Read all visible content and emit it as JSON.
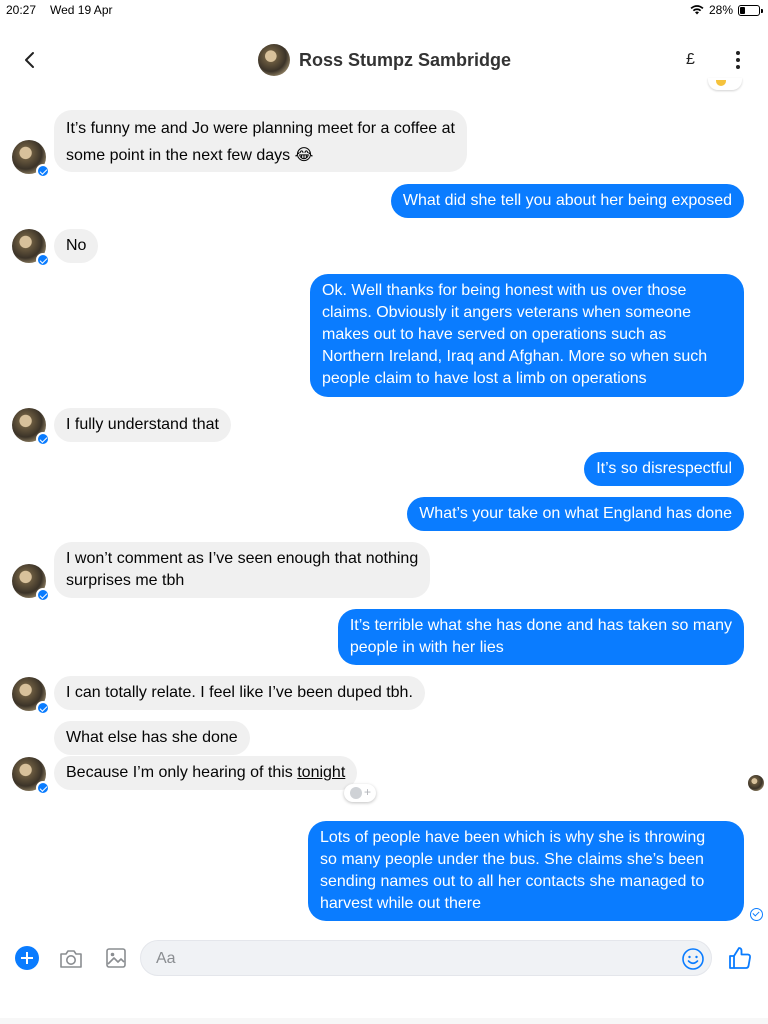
{
  "status_bar": {
    "time": "20:27",
    "date": "Wed 19 Apr",
    "battery_text": "28%",
    "battery_level": 0.28
  },
  "header": {
    "contact_name": "Ross Stumpz Sambridge",
    "currency_symbol": "£"
  },
  "messages": [
    {
      "direction": "in",
      "text": "It’s funny me and Jo were planning meet for a coffee at\nsome point in the next few days 😂"
    },
    {
      "direction": "out",
      "text": "What did she tell you about her being exposed"
    },
    {
      "direction": "in",
      "text": "No"
    },
    {
      "direction": "out",
      "text": "Ok. Well thanks for being honest with us over those\nclaims. Obviously it angers veterans when someone\nmakes out to have served on operations such as\nNorthern Ireland, Iraq and Afghan. More so when such\npeople claim to have lost a limb on operations"
    },
    {
      "direction": "in",
      "text": "I fully understand that"
    },
    {
      "direction": "out",
      "text": "It’s so disrespectful"
    },
    {
      "direction": "out",
      "text": "What’s your take on what England has done"
    },
    {
      "direction": "in",
      "text": "I won’t comment as I’ve seen enough that nothing\nsurprises me tbh"
    },
    {
      "direction": "out",
      "text": "It’s terrible what she has done and has taken so many\npeople in with her lies"
    },
    {
      "direction": "in",
      "text": "I can totally relate. I feel like I’ve been duped tbh."
    },
    {
      "direction": "in",
      "text": "What else has she done"
    },
    {
      "direction": "in",
      "text_before": "Because I’m only hearing of this ",
      "text_underlined": "tonight"
    },
    {
      "direction": "out",
      "text": "Lots of people have been which is why she is throwing\nso many people under the bus. She claims she’s been\nsending names out to all her contacts she managed to\nharvest while out there"
    }
  ],
  "composer": {
    "placeholder": "Aa"
  },
  "icons": {
    "back": "chevron-left-icon",
    "more": "more-vertical-icon",
    "plus": "plus-icon",
    "camera": "camera-icon",
    "gallery": "image-icon",
    "emoji": "smiley-icon",
    "like": "thumbs-up-icon"
  },
  "colors": {
    "outgoing_bubble": "#0a7cff",
    "incoming_bubble": "#f0f0f0",
    "accent": "#0a7cff"
  }
}
